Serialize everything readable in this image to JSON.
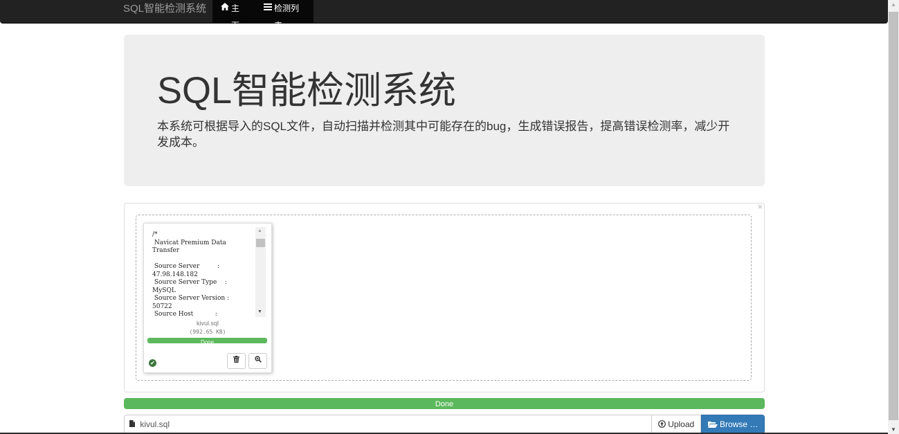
{
  "navbar": {
    "brand": "SQL智能检测系统",
    "items": [
      {
        "label": "主页",
        "icon": "home-icon"
      },
      {
        "label": "检测列表",
        "icon": "list-icon"
      }
    ]
  },
  "jumbotron": {
    "title": "SQL智能检测系统",
    "description": "本系统可根据导入的SQL文件，自动扫描并检测其中可能存在的bug，生成错误报告，提高错误检测率，减少开发成本。"
  },
  "file_preview": {
    "content": "/*\n Navicat Premium Data\nTransfer\n\n Source Server         :\n47.98.148.182\n Source Server Type    :\nMySQL\n Source Server Version :\n50722\n Source Host           :",
    "file_name": "kivul.sql",
    "file_size": "(992.65 KB)",
    "progress_label": "Done",
    "progress": 1.0
  },
  "panel": {
    "close_label": "×"
  },
  "main_progress": {
    "label": "Done",
    "progress": 1.0
  },
  "file_input": {
    "caption": "kivul.sql",
    "upload_label": "Upload",
    "browse_label": "Browse …"
  },
  "colors": {
    "navbar_bg": "#222222",
    "success": "#5cb85c",
    "primary": "#337ab7",
    "jumbotron_bg": "#eeeeee"
  }
}
